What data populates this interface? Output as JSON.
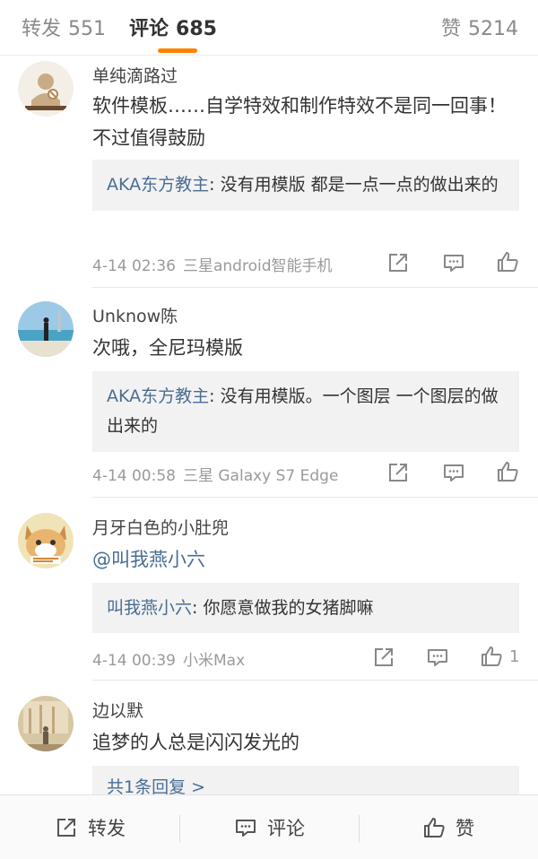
{
  "tabs": {
    "repost": {
      "label": "转发",
      "count": "551"
    },
    "comments": {
      "label": "评论",
      "count": "685"
    },
    "likes": {
      "label": "赞",
      "count": "5214"
    }
  },
  "comments": [
    {
      "user": "单纯滴路过",
      "text": "软件模板……自学特效和制作特效不是同一回事！不过值得鼓励",
      "reply": {
        "name": "AKA东方教主",
        "text": ": 没有用模版  都是一点一点的做出来的"
      },
      "time": "4-14 02:36",
      "device": "三星android智能手机",
      "likes": ""
    },
    {
      "user": "Unknow陈",
      "text": "次哦，全尼玛模版",
      "reply": {
        "name": "AKA东方教主",
        "text": ": 没有用模版。一个图层 一个图层的做出来的"
      },
      "time": "4-14 00:58",
      "device": "三星 Galaxy S7 Edge",
      "likes": ""
    },
    {
      "user": "月牙白色的小肚兜",
      "text": "@叫我燕小六",
      "reply": {
        "name": "叫我燕小六",
        "text": ": 你愿意做我的女猪脚嘛"
      },
      "time": "4-14 00:39",
      "device": "小米Max",
      "likes": "1"
    },
    {
      "user": "边以默",
      "text": "追梦的人总是闪闪发光的",
      "reply_summary": "共1条回复 >"
    }
  ],
  "bottom_bar": {
    "repost": "转发",
    "comment": "评论",
    "like": "赞"
  },
  "colors": {
    "accent": "#ff8200",
    "link": "#496d94"
  }
}
